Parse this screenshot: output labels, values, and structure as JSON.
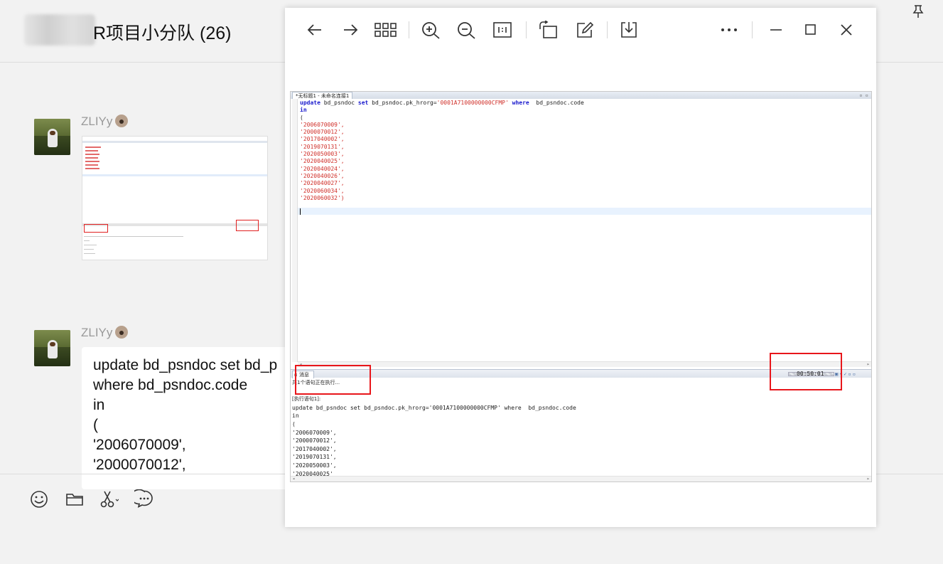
{
  "chat": {
    "title": "R项目小分队 (26)",
    "messages": [
      {
        "sender": "ZLIYy"
      },
      {
        "sender": "ZLIYy",
        "lines": [
          "update bd_psndoc set bd_p",
          "where  bd_psndoc.code",
          "in",
          "(",
          "'2006070009',",
          "'2000070012',"
        ]
      }
    ]
  },
  "viewer": {
    "toolbar": [
      "back-icon",
      "forward-icon",
      "grid-icon",
      "zoom-in-icon",
      "zoom-out-icon",
      "actual-size-icon",
      "rotate-icon",
      "edit-icon",
      "download-icon",
      "more-icon",
      "minimize-icon",
      "maximize-icon",
      "close-icon"
    ],
    "screenshot": {
      "editor_tab": "*无标题1 - 未命名连接1",
      "code": {
        "line1_kw1": "update",
        "line1_a": " bd_psndoc ",
        "line1_kw2": "set",
        "line1_b": " bd_psndoc.pk_hrorg=",
        "line1_str": "'0001A7100000000CFMP'",
        "line1_c": " ",
        "line1_kw3": "where",
        "line1_d": "  bd_psndoc.code",
        "line2_kw": "in",
        "values": [
          "(",
          "'2006070009',",
          "'2000070012',",
          "'2017040002',",
          "'2019070131',",
          "'2020050003',",
          "'2020040025',",
          "'2020040024',",
          "'2020040026',",
          "'2020040027',",
          "'2020060034',",
          "'2020060032')"
        ]
      },
      "messages_tab": "消息",
      "timer": "00:50:01",
      "output": {
        "status": "共1个语句正在执行...",
        "exec_label": "[执行语句1]:",
        "lines": [
          "update bd_psndoc set bd_psndoc.pk_hrorg='0001A7100000000CFMP' where  bd_psndoc.code",
          "in",
          "(",
          "'2006070009',",
          "'2000070012',",
          "'2017040002',",
          "'2019070131',",
          "'2020050003',",
          "'2020040025'"
        ]
      }
    }
  },
  "colors": {
    "highlight_red": "#e8161b",
    "keyword": "#1a1acd",
    "string": "#d0302a"
  }
}
